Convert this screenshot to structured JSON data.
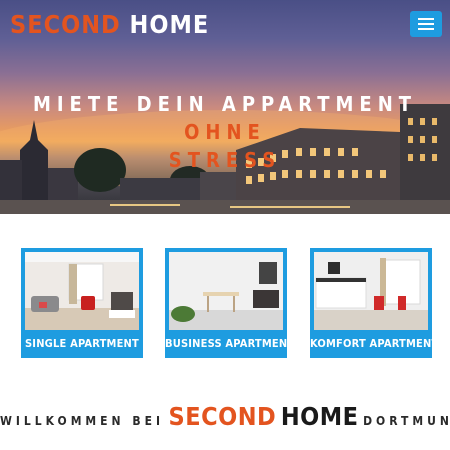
{
  "brand": {
    "part1": "SECOND",
    "part2": "HOME"
  },
  "menu_icon": "hamburger-icon",
  "hero": {
    "line1_white": "MIETE DEIN APPARTMENT",
    "line1_orange": "OHNE",
    "line2_orange": "STRESS"
  },
  "cards": [
    {
      "label": "SINGLE APARTMENT"
    },
    {
      "label": "BUSINESS APARTMENT"
    },
    {
      "label": "KOMFORT APARTMENT"
    }
  ],
  "welcome": {
    "prefix": "WILLKOMMEN BEI",
    "brand1": "SECOND",
    "brand2": "HOME",
    "suffix": "DORTMUND"
  },
  "colors": {
    "accent_orange": "#e3541f",
    "accent_blue": "#1e9ce0"
  }
}
